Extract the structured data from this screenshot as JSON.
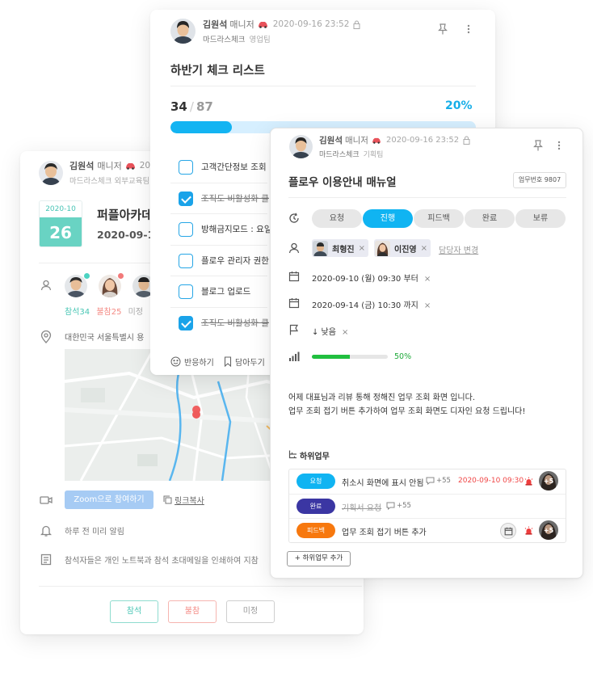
{
  "event_card": {
    "author_name": "김원석",
    "author_role": "매니저",
    "author_ts": "20",
    "company": "마드라스체크",
    "team": "외부교육팀",
    "date_box_ym": "2020-10",
    "date_box_day": "26",
    "title": "퍼플아카데미",
    "date": "2020-09-16",
    "stats": {
      "attend": "참석34",
      "absent": "불참25",
      "undecided": "미정"
    },
    "address": "대한민국 서울특별시 용",
    "zoom_button": "Zoom으로 참여하기",
    "copy_link": "링크복사",
    "notify": "하루 전 미리 알림",
    "memo": "참석자들은 개인 노트북과 참석 초대메일을 인쇄하여 지참",
    "rsvp": {
      "attend": "참석",
      "absent": "불참",
      "undecided": "미정"
    },
    "colors": {
      "attend": "#48c6b4",
      "absent": "#f48a84",
      "dot_green": "#4cd3c2",
      "dot_red": "#f27a7a"
    }
  },
  "checklist_card": {
    "author_name": "김원석",
    "author_role": "매니저",
    "timestamp": "2020-09-16 23:52",
    "company": "마드라스체크",
    "team": "영업팀",
    "title": "하반기 체크 리스트",
    "done": "34",
    "total": "87",
    "percent_label": "20%",
    "progress": 0.2,
    "items": [
      {
        "label": "고객간단정보 조회",
        "checked": false
      },
      {
        "label": "조직도 비활성화 클",
        "checked": true
      },
      {
        "label": "방해금지모드 : 요일",
        "checked": false
      },
      {
        "label": "플로우 관리자 권한",
        "checked": false
      },
      {
        "label": "블로그 업로드",
        "checked": false
      },
      {
        "label": "조직도 비활성화 클",
        "checked": true
      }
    ],
    "react_label": "반응하기",
    "save_label": "담아두기",
    "accent": "#13b4f2"
  },
  "task_card": {
    "author_name": "김원석",
    "author_role": "매니저",
    "timestamp": "2020-09-16 23:52",
    "company": "마드라스체크",
    "team": "기획팀",
    "title": "플로우 이용안내 매뉴얼",
    "task_number": "업무번호 9807",
    "statuses": [
      "요청",
      "진행",
      "피드백",
      "완료",
      "보류"
    ],
    "active_status": "진행",
    "assignees": [
      "최형진",
      "이진영"
    ],
    "change_assignee": "담당자 변경",
    "start": "2020-09-10 (월) 09:30 부터",
    "end": "2020-09-14 (금) 10:30 까지",
    "priority": "↓ 낮음",
    "progress_label": "50%",
    "progress": 0.5,
    "remove_mark": "×",
    "description": [
      "어제 대표님과 리뷰 통해 정해진 업무 조회 화면 입니다.",
      "업무 조회 접기 버튼 추가하여 업무 조회 화면도 디자인 요청 드립니다!"
    ],
    "subtasks_title": "하위업무",
    "subtasks": [
      {
        "status": "요청",
        "color": "#10b4f2",
        "title": "취소시 화면에 표시 안됨",
        "comments": "+55",
        "due": "2020-09-10 09:30",
        "extra": "+5"
      },
      {
        "status": "완료",
        "color": "#3b36a3",
        "title": "기획서 요청",
        "comments": "+55"
      },
      {
        "status": "피드백",
        "color": "#f7780e",
        "title": "업무 조회 접기 버튼 추가",
        "extra": "+5"
      }
    ],
    "add_subtask": "+ 하위업무 추가"
  }
}
